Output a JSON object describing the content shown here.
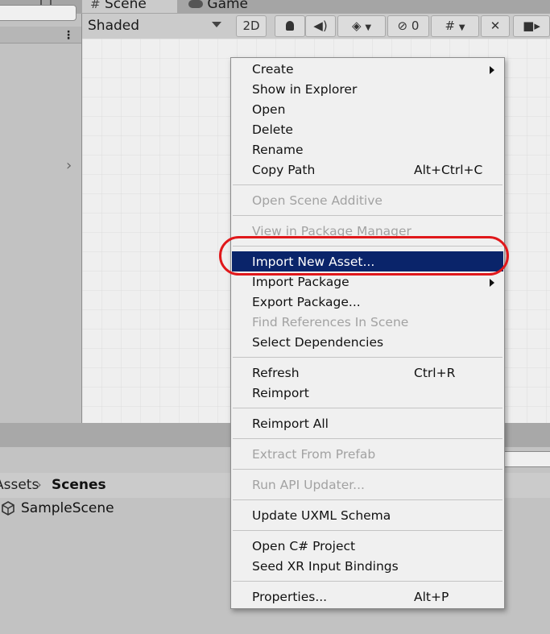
{
  "tabs": [
    {
      "label": "Scene",
      "icon": "hash-icon"
    },
    {
      "label": "Game",
      "icon": "gamepad-icon"
    }
  ],
  "toolbar": {
    "shading_mode": "Shaded",
    "view_2d_label": "2D",
    "visibility_count": "0",
    "icons": [
      "lightbulb-icon",
      "audio-icon",
      "effects-layers-icon",
      "hidden-objects-icon",
      "gizmos-grid-icon",
      "tools-icon",
      "camera-icon"
    ]
  },
  "context_menu": {
    "items": [
      {
        "label": "Create",
        "submenu": true
      },
      {
        "label": "Show in Explorer"
      },
      {
        "label": "Open"
      },
      {
        "label": "Delete"
      },
      {
        "label": "Rename"
      },
      {
        "label": "Copy Path",
        "shortcut": "Alt+Ctrl+C"
      },
      {
        "label": "Open Scene Additive",
        "disabled": true
      },
      {
        "label": "View in Package Manager",
        "disabled": true
      },
      {
        "label": "Import New Asset...",
        "highlighted": true
      },
      {
        "label": "Import Package",
        "submenu": true
      },
      {
        "label": "Export Package..."
      },
      {
        "label": "Find References In Scene",
        "disabled": true
      },
      {
        "label": "Select Dependencies"
      },
      {
        "label": "Refresh",
        "shortcut": "Ctrl+R"
      },
      {
        "label": "Reimport"
      },
      {
        "label": "Reimport All"
      },
      {
        "label": "Extract From Prefab",
        "disabled": true
      },
      {
        "label": "Run API Updater...",
        "disabled": true
      },
      {
        "label": "Update UXML Schema"
      },
      {
        "label": "Open C# Project"
      },
      {
        "label": "Seed XR Input Bindings"
      },
      {
        "label": "Properties...",
        "shortcut": "Alt+P"
      }
    ]
  },
  "project": {
    "breadcrumb": [
      "Assets",
      "Scenes"
    ],
    "files": [
      {
        "label": "SampleScene",
        "icon": "unity-scene-icon"
      }
    ]
  },
  "colors": {
    "highlight": "#0a246a",
    "annotation": "#e0181b",
    "menu_bg": "#f0f0f0"
  }
}
